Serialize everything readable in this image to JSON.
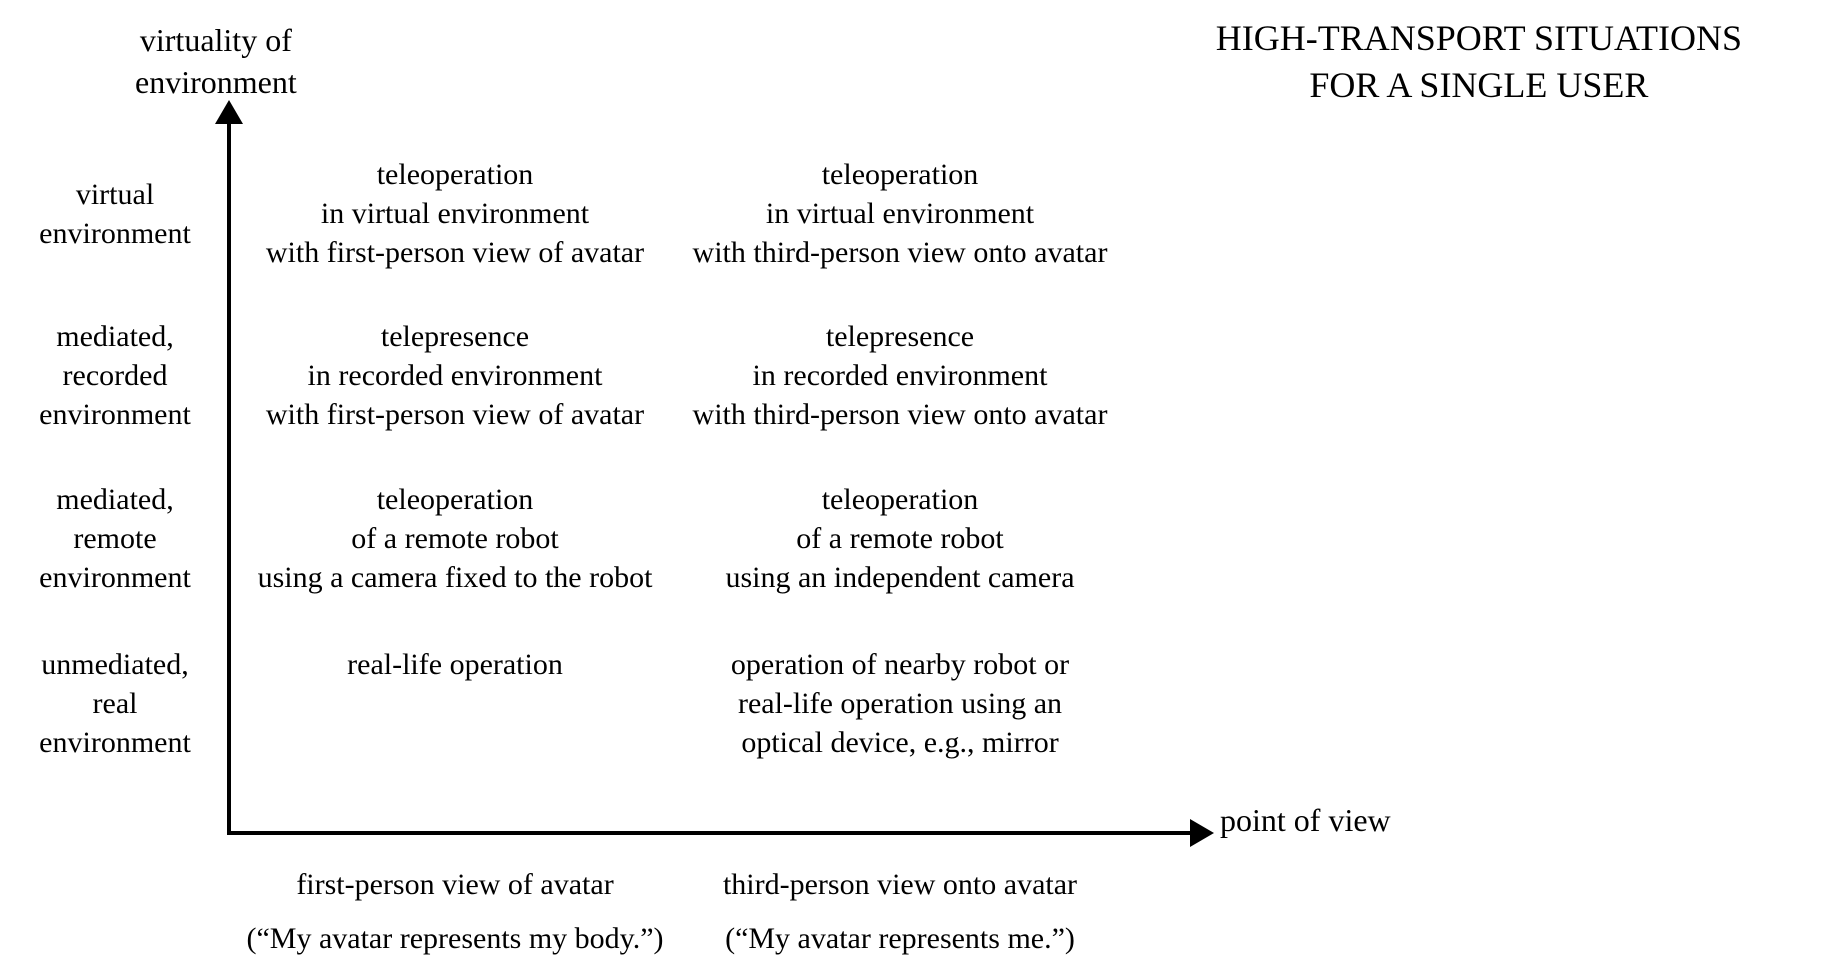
{
  "title": {
    "line1": "HIGH-TRANSPORT SITUATIONS",
    "line2": "FOR A SINGLE USER"
  },
  "axes": {
    "y_label_line1": "virtuality of",
    "y_label_line2": "environment",
    "x_label": "point of view"
  },
  "rows": [
    {
      "label_line1": "virtual",
      "label_line2": "environment",
      "label_line3": "",
      "col1_line1": "teleoperation",
      "col1_line2": "in virtual environment",
      "col1_line3": "with first-person view of avatar",
      "col2_line1": "teleoperation",
      "col2_line2": "in virtual environment",
      "col2_line3": "with third-person view onto avatar"
    },
    {
      "label_line1": "mediated,",
      "label_line2": "recorded",
      "label_line3": "environment",
      "col1_line1": "telepresence",
      "col1_line2": "in recorded environment",
      "col1_line3": "with first-person view of avatar",
      "col2_line1": "telepresence",
      "col2_line2": "in recorded environment",
      "col2_line3": "with third-person view onto avatar"
    },
    {
      "label_line1": "mediated,",
      "label_line2": "remote",
      "label_line3": "environment",
      "col1_line1": "teleoperation",
      "col1_line2": "of a remote robot",
      "col1_line3": "using a camera fixed to the robot",
      "col2_line1": "teleoperation",
      "col2_line2": "of a remote robot",
      "col2_line3": "using an independent camera"
    },
    {
      "label_line1": "unmediated,",
      "label_line2": "real",
      "label_line3": "environment",
      "col1_line1": "real-life operation",
      "col1_line2": "",
      "col1_line3": "",
      "col2_line1": "operation of nearby robot or",
      "col2_line2": "real-life operation using an",
      "col2_line3": "optical device, e.g., mirror"
    }
  ],
  "columns": [
    {
      "label_line1": "first-person view of avatar",
      "label_line2": "(“My avatar represents my body.”)"
    },
    {
      "label_line1": "third-person view onto avatar",
      "label_line2": "(“My avatar represents me.”)"
    }
  ],
  "chart_data": {
    "type": "table",
    "title": "HIGH-TRANSPORT SITUATIONS FOR A SINGLE USER",
    "x_axis": "point of view",
    "y_axis": "virtuality of environment",
    "y_categories": [
      "virtual environment",
      "mediated, recorded environment",
      "mediated, remote environment",
      "unmediated, real environment"
    ],
    "x_categories": [
      "first-person view of avatar (\"My avatar represents my body.\")",
      "third-person view onto avatar (\"My avatar represents me.\")"
    ],
    "cells": [
      [
        "teleoperation in virtual environment with first-person view of avatar",
        "teleoperation in virtual environment with third-person view onto avatar"
      ],
      [
        "telepresence in recorded environment with first-person view of avatar",
        "telepresence in recorded environment with third-person view onto avatar"
      ],
      [
        "teleoperation of a remote robot using a camera fixed to the robot",
        "teleoperation of a remote robot using an independent camera"
      ],
      [
        "real-life operation",
        "operation of nearby robot or real-life operation using an optical device, e.g., mirror"
      ]
    ]
  }
}
